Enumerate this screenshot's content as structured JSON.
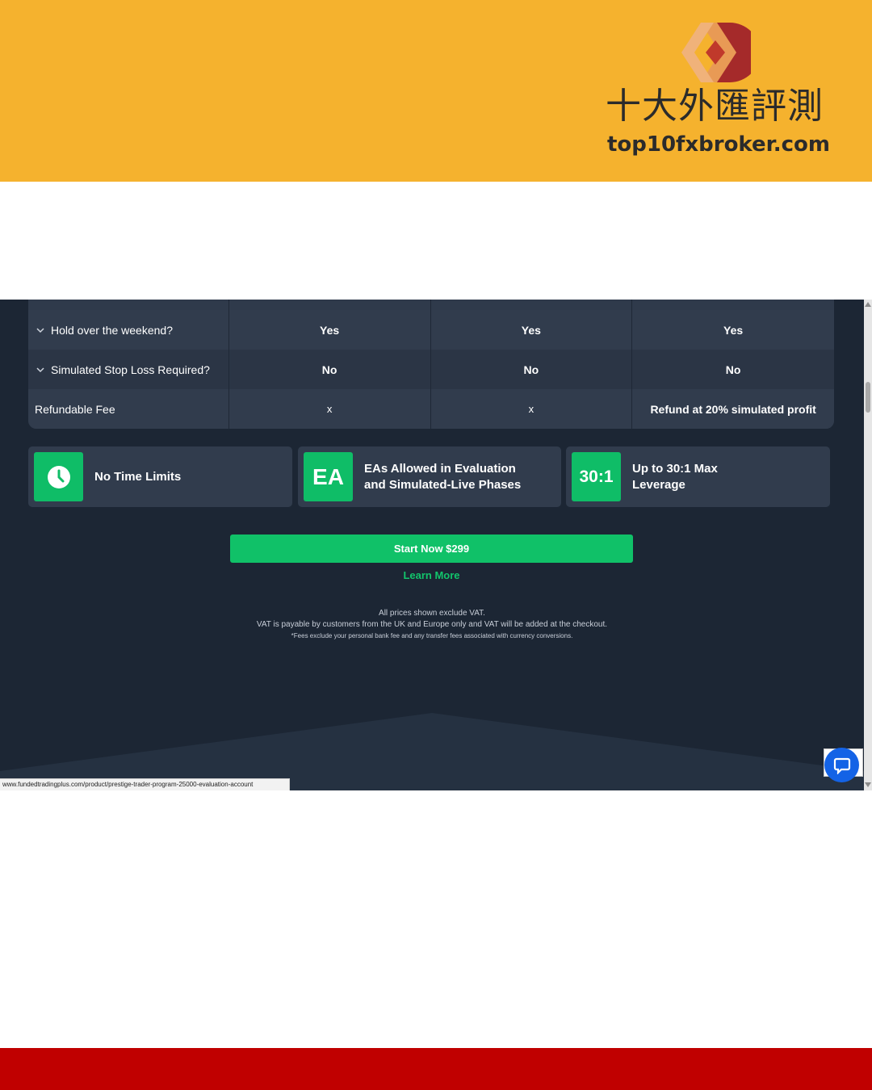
{
  "banner": {
    "logo_cn": "十大外匯評測",
    "logo_en": "top10fxbroker.com",
    "background": "#f5b22e"
  },
  "table": {
    "rows": [
      {
        "label": "Hold over the weekend?",
        "values": [
          "Yes",
          "Yes",
          "Yes"
        ],
        "expandable": true
      },
      {
        "label": "Simulated Stop Loss Required?",
        "values": [
          "No",
          "No",
          "No"
        ],
        "expandable": true
      },
      {
        "label": "Refundable Fee",
        "values": [
          "x",
          "x",
          "Refund at 20% simulated profit"
        ],
        "expandable": false
      }
    ]
  },
  "features": [
    {
      "icon": "clock-icon",
      "line1": "No Time Limits",
      "line2": ""
    },
    {
      "icon": "ea-icon",
      "tile_text": "EA",
      "line1": "EAs Allowed in Evaluation",
      "line2": "and Simulated-Live Phases"
    },
    {
      "icon": "leverage-icon",
      "tile_text": "30:1",
      "line1": "Up to 30:1 Max",
      "line2": "Leverage"
    }
  ],
  "cta": {
    "start_label": "Start Now $299",
    "learn_more_label": "Learn More"
  },
  "notes": {
    "line1": "All prices shown exclude VAT.",
    "line2": "VAT is payable by customers from the UK and Europe only and VAT will be added at the checkout.",
    "line3": "*Fees exclude your personal bank fee and any transfer fees associated with currency conversions."
  },
  "status_url": "www.fundedtradingplus.com/product/prestige-trader-program-25000-evaluation-account",
  "colors": {
    "accent_green": "#10c168",
    "page_dark": "#1c2634",
    "card": "#313c4d",
    "chat_blue": "#1463e6",
    "footer_red": "#c00000"
  }
}
